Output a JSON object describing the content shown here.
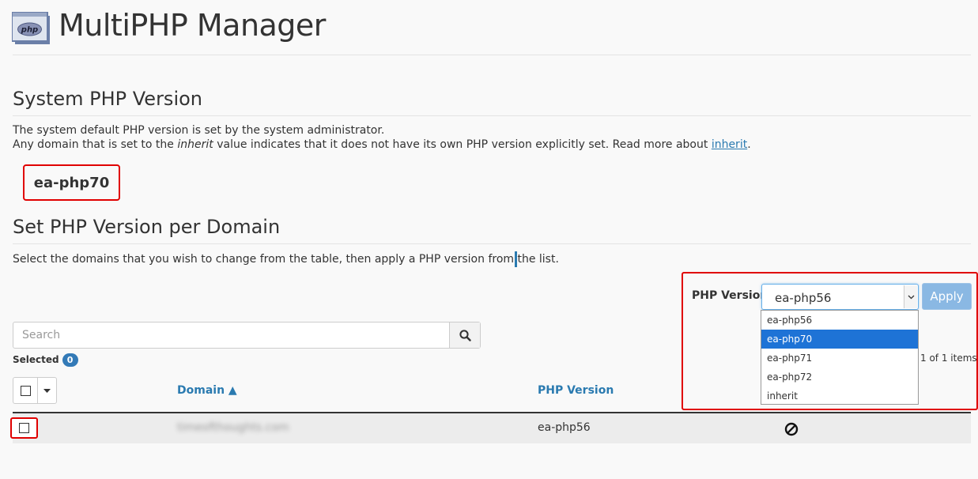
{
  "header": {
    "title": "MultiPHP Manager",
    "icon_text": "php"
  },
  "system_section": {
    "heading": "System PHP Version",
    "desc_line1": "The system default PHP version is set by the system administrator.",
    "desc_line2_before": "Any domain that is set to the ",
    "desc_line2_em": "inherit",
    "desc_line2_after": " value indicates that it does not have its own PHP version explicitly set. Read more about ",
    "desc_line2_link": "inherit",
    "desc_line2_end": ".",
    "system_version": "ea-php70"
  },
  "domain_section": {
    "heading": "Set PHP Version per Domain",
    "instructions": "Select the domains that you wish to change from the table, then apply a PHP version from the list.",
    "php_version_label": "PHP Version",
    "select_value": "ea-php56",
    "apply_label": "Apply",
    "options": [
      "ea-php56",
      "ea-php70",
      "ea-php71",
      "ea-php72",
      "inherit"
    ],
    "highlighted_option": "ea-php70",
    "search_placeholder": "Search",
    "selected_label": "Selected",
    "selected_count": "0",
    "items_count": "1 of 1 items"
  },
  "table": {
    "columns": [
      "Domain ▲",
      "PHP Version"
    ],
    "rows": [
      {
        "domain": "timeofthoughts.com",
        "php_version": "ea-php56",
        "status_icon": "no-entry-icon"
      }
    ]
  },
  "colors": {
    "accent": "#2a7ab0",
    "highlight_border": "#e00000",
    "option_selected": "#1e73d6",
    "apply_button": "#8ab8e3"
  }
}
